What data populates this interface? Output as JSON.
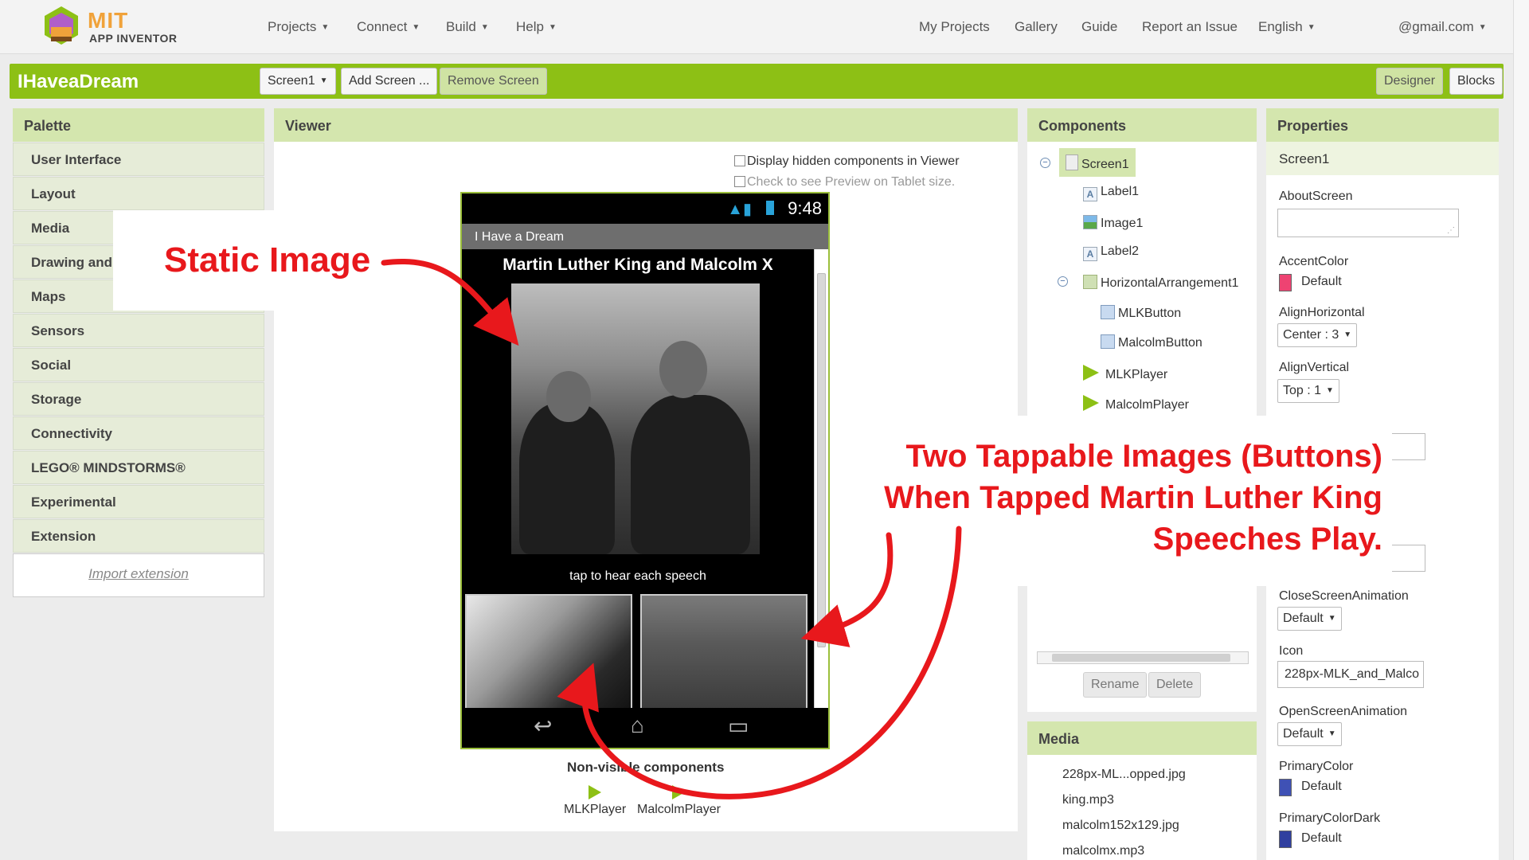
{
  "brand": {
    "mit": "MIT",
    "sub": "APP INVENTOR"
  },
  "topnav": {
    "left": [
      {
        "label": "Projects"
      },
      {
        "label": "Connect"
      },
      {
        "label": "Build"
      },
      {
        "label": "Help"
      }
    ],
    "right": [
      "My Projects",
      "Gallery",
      "Guide",
      "Report an Issue"
    ],
    "language": "English",
    "account": "@gmail.com"
  },
  "project": {
    "name": "IHaveaDream",
    "screen_select": "Screen1",
    "add_screen": "Add Screen ...",
    "remove_screen": "Remove Screen",
    "designer": "Designer",
    "blocks": "Blocks"
  },
  "palette": {
    "title": "Palette",
    "items": [
      "User Interface",
      "Layout",
      "Media",
      "Drawing and",
      "Maps",
      "Sensors",
      "Social",
      "Storage",
      "Connectivity",
      "LEGO® MINDSTORMS®",
      "Experimental",
      "Extension"
    ],
    "import": "Import extension"
  },
  "viewer": {
    "title": "Viewer",
    "hidden_check": "Display hidden components in Viewer",
    "tablet_check": "Check to see Preview on Tablet size.",
    "phone": {
      "time": "9:48",
      "app_title": "I Have a Dream",
      "label1": "Martin Luther King and Malcolm X",
      "label2": "tap to hear each speech"
    },
    "nonvisible_title": "Non-visible components",
    "nonvisible": [
      "MLKPlayer",
      "MalcolmPlayer"
    ]
  },
  "components": {
    "title": "Components",
    "tree": [
      "Screen1",
      "Label1",
      "Image1",
      "Label2",
      "HorizontalArrangement1",
      "MLKButton",
      "MalcolmButton",
      "MLKPlayer",
      "MalcolmPlayer"
    ],
    "rename": "Rename",
    "delete": "Delete"
  },
  "media": {
    "title": "Media",
    "items": [
      "228px-ML...opped.jpg",
      "king.mp3",
      "malcolm152x129.jpg",
      "malcolmx.mp3"
    ]
  },
  "properties": {
    "title": "Properties",
    "component": "Screen1",
    "about_screen": "AboutScreen",
    "accent_color": "AccentColor",
    "accent_value": "Default",
    "align_h": "AlignHorizontal",
    "align_h_value": "Center : 3",
    "align_v": "AlignVertical",
    "align_v_value": "Top : 1",
    "close_anim": "CloseScreenAnimation",
    "close_anim_value": "Default",
    "icon": "Icon",
    "icon_value": "228px-MLK_and_Malco",
    "open_anim": "OpenScreenAnimation",
    "open_anim_value": "Default",
    "primary": "PrimaryColor",
    "primary_value": "Default",
    "primary_dark": "PrimaryColorDark",
    "primary_dark_value": "Default"
  },
  "annotations": {
    "static_image": "Static Image",
    "buttons_line1": "Two Tappable Images (Buttons)",
    "buttons_line2": "When Tapped Martin Luther King",
    "buttons_line3": "Speeches Play."
  },
  "colors": {
    "accent": "#8dc015",
    "annotation_red": "#e8181c",
    "accent_swatch": "#ee4372",
    "primary_swatch": "#3f51b5",
    "primary_dark_swatch": "#303f9f"
  },
  "icons": {
    "logo": "app-inventor-logo-icon",
    "dropdown": "caret-down-icon",
    "sound": "play-triangle-icon"
  }
}
